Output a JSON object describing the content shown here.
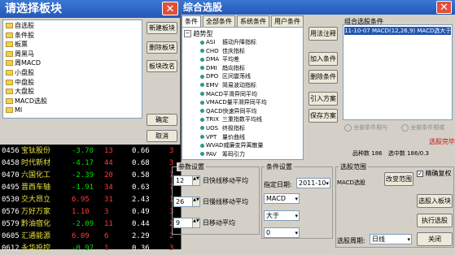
{
  "colors": {
    "title_blue": "#2b63c4",
    "stock_bg": "#000000",
    "up_red": "#ff3b3b",
    "down_green": "#00e000",
    "name_yellow": "#e8e040",
    "close_red": "#e0503a"
  },
  "board_dialog": {
    "title": "请选择板块",
    "items": [
      "自选股",
      "条件股",
      "板票",
      "周黑马",
      "周MACD",
      "小盘股",
      "中盘股",
      "大盘股",
      "MACD选股",
      "MI"
    ],
    "buttons": {
      "new": "新建板块",
      "delete": "删除板块",
      "rename": "板块改名",
      "ok": "确定",
      "cancel": "取消"
    }
  },
  "stock_list": [
    {
      "code": "0456",
      "name": "宝钛股份",
      "change": "-3.70",
      "volume": "13",
      "ratio": "0.66",
      "flag": "3"
    },
    {
      "code": "0458",
      "name": "时代新材",
      "change": "-4.17",
      "volume": "44",
      "ratio": "0.68",
      "flag": "3"
    },
    {
      "code": "0470",
      "name": "六国化工",
      "change": "-2.39",
      "volume": "20",
      "ratio": "0.58",
      "flag": "7"
    },
    {
      "code": "0495",
      "name": "晋西车轴",
      "change": "-1.91",
      "volume": "34",
      "ratio": "0.63",
      "flag": "7"
    },
    {
      "code": "0530",
      "name": "交大昂立",
      "change": "6.95",
      "volume": "31",
      "ratio": "2.43",
      "flag": "1"
    },
    {
      "code": "0576",
      "name": "万好万家",
      "change": "1.10",
      "volume": "3",
      "ratio": "0.49",
      "flag": "3"
    },
    {
      "code": "0579",
      "name": "黔油宿化",
      "change": "-2.09",
      "volume": "11",
      "ratio": "0.44",
      "flag": "2"
    },
    {
      "code": "0605",
      "name": "汇通能源",
      "change": "6.09",
      "volume": "6",
      "ratio": "2.29",
      "flag": "2"
    },
    {
      "code": "0612",
      "name": "永华投控",
      "change": "-0.97",
      "volume": "1",
      "ratio": "0.36",
      "flag": "3"
    }
  ],
  "selector": {
    "title": "综合选股",
    "tabs": [
      "条件组",
      "全部条件",
      "系统条件",
      "用户条件"
    ],
    "tree_root": "趋势型",
    "tree_items": [
      {
        "code": "ASI",
        "desc": "振动升降指标"
      },
      {
        "code": "CHO",
        "desc": "佳庆指标"
      },
      {
        "code": "DMA",
        "desc": "平均差"
      },
      {
        "code": "DMI",
        "desc": "趋向指标"
      },
      {
        "code": "DPO",
        "desc": "区间震荡线"
      },
      {
        "code": "EMV",
        "desc": "简易波动指标"
      },
      {
        "code": "MACD",
        "desc": "平滑异同平均"
      },
      {
        "code": "VMACD",
        "desc": "量平滑异同平均"
      },
      {
        "code": "QACD",
        "desc": "快速异同平均"
      },
      {
        "code": "TRIX",
        "desc": "三重指数平均线"
      },
      {
        "code": "UOS",
        "desc": "终极指标"
      },
      {
        "code": "VPT",
        "desc": "量价曲线"
      },
      {
        "code": "WVAD",
        "desc": "威廉变异离散量"
      },
      {
        "code": "PAV",
        "desc": "筹码引力"
      }
    ],
    "buttons": {
      "explain": "用法注释",
      "add_condition": "加入条件",
      "delete_condition": "删除条件",
      "import_plan": "引入方案",
      "save_plan": "保存方案"
    },
    "combo": {
      "label": "组合选股条件",
      "entry": "11-10-07 MACD(12,26,9) MACD选大于0",
      "radio_all": "全部条件相与",
      "radio_any": "全部条件相或",
      "done": "选股完毕",
      "count_label": "品种数",
      "count_value": "186",
      "selected_label": "选中数",
      "selected_value": "186/0.3"
    },
    "params": {
      "label": "参数设置",
      "rows": [
        {
          "value": "12",
          "text": "日快线移动平均"
        },
        {
          "value": "26",
          "text": "日慢线移动平均"
        },
        {
          "value": "9",
          "text": "日移动平均"
        }
      ]
    },
    "condition": {
      "label": "条件设置",
      "date_label": "指定日期:",
      "date_value": "2011-10-",
      "indicator": "MACD",
      "operator": "大于",
      "value": "0"
    },
    "range": {
      "label": "选股范围",
      "value": "MACD选股",
      "change_button": "改变范围",
      "exact_label": "精确复权",
      "add_to_board": "选股入板块",
      "execute": "执行选股",
      "period_label": "选股周期:",
      "period_value": "日线",
      "close": "关闭"
    }
  }
}
